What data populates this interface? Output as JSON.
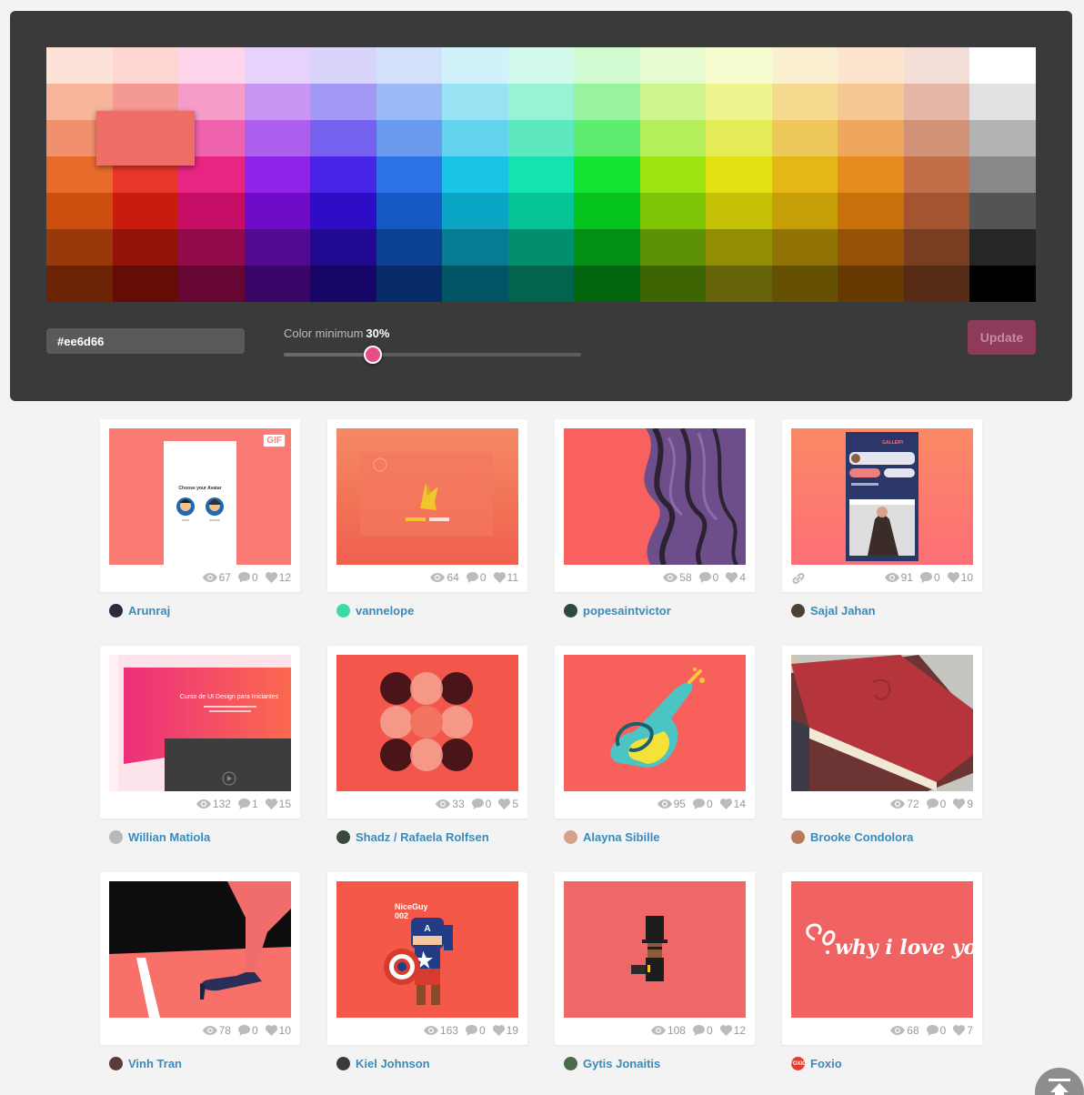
{
  "palette": {
    "rows": [
      [
        "#fde2d7",
        "#fdd6d4",
        "#fdd4ea",
        "#e6d2fc",
        "#d8d4fc",
        "#d4e1fb",
        "#d1f2fb",
        "#d2fbeb",
        "#d3fbd2",
        "#e6fbcf",
        "#f6fbcf",
        "#fbefd1",
        "#fce4cf",
        "#f3ded8",
        "#ffffff"
      ],
      [
        "#f7b59b",
        "#f59a92",
        "#f59cc9",
        "#c895f5",
        "#a398f5",
        "#9ab9f5",
        "#98e4f5",
        "#97f3d3",
        "#98f3a0",
        "#cdf48e",
        "#eef48e",
        "#f5d98f",
        "#f5c893",
        "#e3b6a5",
        "#e2e2e2"
      ],
      [
        "#f1906d",
        "#ef6d62",
        "#ef62ad",
        "#ad5fee",
        "#7462ef",
        "#6a9aee",
        "#64d4ee",
        "#5ee8c0",
        "#5fed71",
        "#b5ee5b",
        "#e5ec5a",
        "#eec85b",
        "#efa75c",
        "#d19277",
        "#b3b3b3"
      ],
      [
        "#e96b2b",
        "#e8362a",
        "#e82582",
        "#8f23e8",
        "#4724e6",
        "#2b73e6",
        "#1ac4e7",
        "#14e2b1",
        "#16e434",
        "#9de612",
        "#e2e112",
        "#e6b617",
        "#e78b1f",
        "#c26f48",
        "#888888"
      ],
      [
        "#cc4f0f",
        "#c91c0d",
        "#c70e67",
        "#6f0cc7",
        "#2f0cc5",
        "#1559c5",
        "#0aa4c5",
        "#05c596",
        "#06c41e",
        "#7ec508",
        "#c4c106",
        "#c69e08",
        "#c87009",
        "#a4552f",
        "#545454"
      ],
      [
        "#993808",
        "#941206",
        "#930a4b",
        "#520a93",
        "#220992",
        "#0c4092",
        "#067b92",
        "#028f6e",
        "#028f14",
        "#5c9105",
        "#918e04",
        "#927305",
        "#955204",
        "#793e21",
        "#262626"
      ],
      [
        "#6c2304",
        "#650c04",
        "#660632",
        "#3a0668",
        "#170667",
        "#072b67",
        "#035566",
        "#02644d",
        "#01660d",
        "#3e6503",
        "#66630b",
        "#655003",
        "#683903",
        "#562c17",
        "#000000"
      ]
    ],
    "selected": "#ee6d66"
  },
  "controls": {
    "hex_value": "#ee6d66",
    "min_label": "Color minimum",
    "min_value": "30%",
    "min_fraction": 0.3,
    "update_label": "Update"
  },
  "shots": [
    {
      "thumb": "avatar-ui",
      "gif": "GIF",
      "views": "67",
      "comments": "0",
      "likes": "12",
      "author": "Arunraj",
      "avatar_color": "#2b2b3a",
      "link": false
    },
    {
      "thumb": "origami",
      "gif": "",
      "views": "64",
      "comments": "0",
      "likes": "11",
      "author": "vannelope",
      "avatar_color": "#3dd9a8",
      "link": false
    },
    {
      "thumb": "brush",
      "gif": "",
      "views": "58",
      "comments": "0",
      "likes": "4",
      "author": "popesaintvictor",
      "avatar_color": "#2f4a3a",
      "link": false
    },
    {
      "thumb": "gallery",
      "gif": "",
      "views": "91",
      "comments": "0",
      "likes": "10",
      "author": "Sajal Jahan",
      "avatar_color": "#4a4238",
      "link": true
    },
    {
      "thumb": "landing",
      "gif": "",
      "views": "132",
      "comments": "1",
      "likes": "15",
      "author": "Willian Matiola",
      "avatar_color": "#b9b9b9",
      "link": false
    },
    {
      "thumb": "circles",
      "gif": "",
      "views": "33",
      "comments": "0",
      "likes": "5",
      "author": "Shadz / Rafaela Rolfsen",
      "avatar_color": "#3a4a3a",
      "link": false
    },
    {
      "thumb": "potion",
      "gif": "",
      "views": "95",
      "comments": "0",
      "likes": "14",
      "author": "Alayna Sibille",
      "avatar_color": "#d9a089",
      "link": false
    },
    {
      "thumb": "book",
      "gif": "",
      "views": "72",
      "comments": "0",
      "likes": "9",
      "author": "Brooke Condolora",
      "avatar_color": "#b87a5a",
      "link": false
    },
    {
      "thumb": "heel",
      "gif": "",
      "views": "78",
      "comments": "0",
      "likes": "10",
      "author": "Vinh Tran",
      "avatar_color": "#5a3a3a",
      "link": false
    },
    {
      "thumb": "hero",
      "gif": "",
      "views": "163",
      "comments": "0",
      "likes": "19",
      "author": "Kiel Johnson",
      "avatar_color": "#3a3a3a",
      "link": false
    },
    {
      "thumb": "hat",
      "gif": "",
      "views": "108",
      "comments": "0",
      "likes": "12",
      "author": "Gytis Jonaitis",
      "avatar_color": "#4a6a4a",
      "link": false
    },
    {
      "thumb": "lettering",
      "gif": "",
      "views": "68",
      "comments": "0",
      "likes": "7",
      "author": "Foxio",
      "avatar_color": "#e63b2e",
      "avatar_text": "FOXIO",
      "link": false
    }
  ],
  "thumb_text": {
    "avatar-ui": "Choose your Avatar",
    "gallery": "GALLERY",
    "landing": "Curso de UI Design para Iniciantes",
    "hero_title": "NiceGuy",
    "hero_num": "002",
    "lettering": "why i love you"
  },
  "icons": {
    "views": "eye-icon",
    "comments": "comment-icon",
    "likes": "heart-icon",
    "link": "link-icon",
    "back_top": "arrow-up-icon"
  },
  "colors": {
    "accent": "#ea4c89",
    "author": "#3a8bbb"
  }
}
